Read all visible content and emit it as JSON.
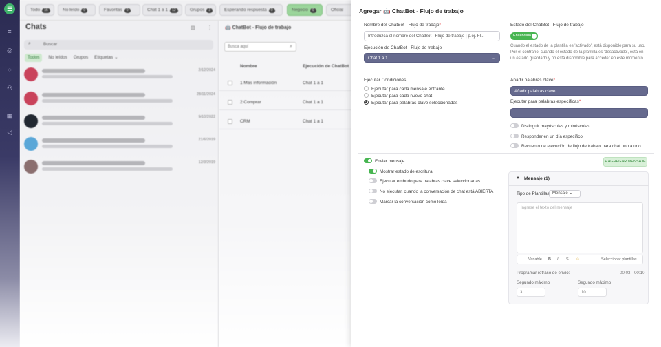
{
  "nav": {
    "icons": [
      "chat-icon",
      "list-icon",
      "broadcast-icon",
      "message-icon",
      "contacts-icon",
      "calendar-icon",
      "megaphone-icon"
    ]
  },
  "tabs": [
    {
      "label": "Todo",
      "count": "16"
    },
    {
      "label": "No leído",
      "count": "0"
    },
    {
      "label": "Favoritas",
      "count": "0"
    },
    {
      "label": "Chat 1 a 1",
      "count": "12"
    },
    {
      "label": "Grupos",
      "count": "3"
    },
    {
      "label": "Esperando respuesta",
      "count": "0"
    },
    {
      "label": "Negocio",
      "count": "0"
    },
    {
      "label": "Oficial",
      "count": "0"
    }
  ],
  "chats": {
    "title": "Chats",
    "search_placeholder": "Buscar",
    "filters": [
      "Todos",
      "No leídos",
      "Grupos",
      "Etiquetas"
    ],
    "rows": [
      {
        "date": "2/12/2024",
        "color": "#c9435b"
      },
      {
        "date": "28/11/2024",
        "color": "#c9435b"
      },
      {
        "date": "9/10/2022",
        "color": "#222831"
      },
      {
        "date": "21/6/2019",
        "color": "#5aa7d8"
      },
      {
        "date": "12/3/2019",
        "color": "#8b6f6f"
      }
    ]
  },
  "flows": {
    "header": "ChatBot - Flujo de trabajo",
    "search_placeholder": "Busca aquí",
    "columns": [
      "Nombre",
      "Ejecución de ChatBot"
    ],
    "rows": [
      {
        "name": "1 Mas información",
        "exec": "Chat 1 a 1"
      },
      {
        "name": "2 Comprar",
        "exec": "Chat 1 a 1"
      },
      {
        "name": "CRM",
        "exec": "Chat 1 a 1"
      }
    ]
  },
  "drawer": {
    "title": "Agregar 🤖 ChatBot - Flujo de trabajo",
    "name_label": "Nombre del ChatBot - Flujo de trabajo",
    "name_placeholder": "Introduzca el nombre del ChatBot - Flujo de trabajo | p.ej. Fl...",
    "exec_label": "Ejecución de ChatBot - Flujo de trabajo",
    "exec_value": "Chat 1 a 1",
    "state_label": "Estado del ChatBot - Flujo de trabajo",
    "state_value": "Encendido",
    "state_help": "Cuando el estado de la plantilla es 'activado', está disponible para su uso. Por el contrario, cuando el estado de la plantilla es 'desactivado', está en un estado guardado y no está disponible para acceder en este momento.",
    "conditions_label": "Ejecutar Condiciones",
    "conditions": [
      {
        "label": "Ejecutar para cada mensaje entrante",
        "selected": false
      },
      {
        "label": "Ejecutar para cada nuevo chat",
        "selected": false
      },
      {
        "label": "Ejecutar para palabras clave seleccionadas",
        "selected": true
      }
    ],
    "keywords_label": "Añadir palabras clave",
    "keywords_value": "Añadir palabras clave",
    "specific_label": "Ejecutar para palabras específicas",
    "keyword_toggles": [
      "Distinguir mayúsculas y minúsculas",
      "Responder en un día específico",
      "Recuento de ejecución de flujo de trabajo para chat uno a uno"
    ],
    "send_toggles": [
      {
        "label": "Enviar mensaje",
        "on": true
      },
      {
        "label": "Mostrar estado de escritura",
        "on": true
      },
      {
        "label": "Ejecutar embudo para palabras clave seleccionadas",
        "on": false
      },
      {
        "label": "No ejecutar, cuando la conversación de chat está ABIERTA",
        "on": false
      },
      {
        "label": "Marcar la conversación como leída",
        "on": false
      }
    ],
    "add_message_label": "+ AGREGAR MENSAJE",
    "message": {
      "title": "Mensaje (1)",
      "type_label": "Tipo de Plantillas",
      "type_value": "Mensaje",
      "text_placeholder": "Ingrese el texto del mensaje",
      "tools": [
        "Variable",
        "B",
        "I",
        "S",
        "☺"
      ],
      "select_templates": "Seleccionar plantillas",
      "delay_label": "Programar retraso de envío:",
      "delay_value": "00:03 - 00:10",
      "min_label": "Segundo máximo",
      "min_value": "3",
      "max_label": "Segundo máximo",
      "max_value": "10"
    }
  },
  "colors": {
    "accent_green": "#47b551",
    "dark_field": "#666a8e",
    "rail": "#2b2b52"
  }
}
